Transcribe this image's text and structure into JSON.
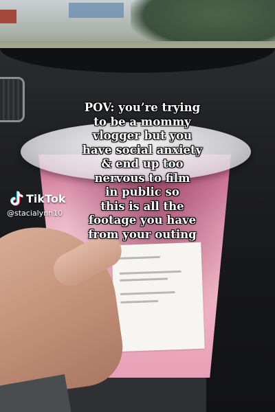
{
  "caption": {
    "lines": [
      "POV: you’re trying",
      "to be a mommy",
      "vlogger but you",
      "have social anxiety",
      "& end up too",
      "nervous to film",
      "in public so",
      "this is all the",
      "footage you have",
      "from your outing"
    ]
  },
  "watermark": {
    "brand": "TikTok",
    "username": "@stacialynn10",
    "icon": "tiktok-logo-icon"
  },
  "colors": {
    "drink": "#e7a3b9",
    "caption_text": "#ffffff"
  }
}
